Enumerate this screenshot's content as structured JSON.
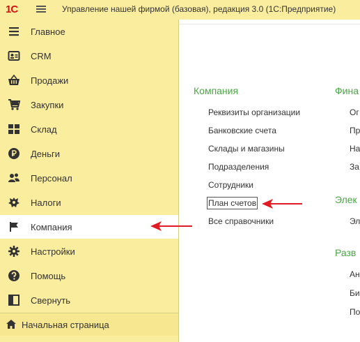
{
  "header": {
    "logo": "1С",
    "title": "Управление нашей фирмой (базовая), редакция 3.0  (1С:Предприятие)"
  },
  "sidebar": {
    "items": [
      {
        "label": "Главное",
        "icon": "menu-lines-icon"
      },
      {
        "label": "CRM",
        "icon": "crm-card-icon"
      },
      {
        "label": "Продажи",
        "icon": "basket-icon"
      },
      {
        "label": "Закупки",
        "icon": "cart-icon"
      },
      {
        "label": "Склад",
        "icon": "warehouse-grid-icon"
      },
      {
        "label": "Деньги",
        "icon": "ruble-coin-icon"
      },
      {
        "label": "Персонал",
        "icon": "people-icon"
      },
      {
        "label": "Налоги",
        "icon": "emblem-icon"
      },
      {
        "label": "Компания",
        "icon": "flag-icon",
        "active": true
      },
      {
        "label": "Настройки",
        "icon": "gear-icon"
      },
      {
        "label": "Помощь",
        "icon": "question-icon"
      },
      {
        "label": "Свернуть",
        "icon": "collapse-panel-icon"
      }
    ],
    "home_label": "Начальная страница"
  },
  "main": {
    "company": {
      "title": "Компания",
      "links": [
        "Реквизиты организации",
        "Банковские счета",
        "Склады и магазины",
        "Подразделения",
        "Сотрудники",
        "План счетов",
        "Все справочники"
      ]
    },
    "finance": {
      "title": "Фина",
      "links": [
        "Ог",
        "Пр",
        "На",
        "За"
      ]
    },
    "electronic": {
      "title": "Элек",
      "links": [
        "Эл"
      ]
    },
    "development": {
      "title": "Разв",
      "links": [
        "Ан",
        "Би",
        "По"
      ]
    }
  },
  "colors": {
    "accent_green": "#4aa644",
    "sidebar_bg": "#fbed9e",
    "arrow_red": "#e01b24",
    "logo_red": "#d40f0f"
  }
}
